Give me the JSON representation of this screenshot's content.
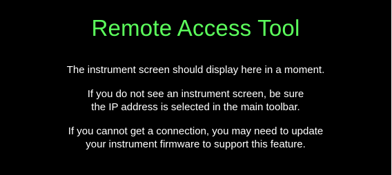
{
  "title": "Remote Access Tool",
  "messages": [
    "The instrument screen should display here in a moment.",
    "If you do not see an instrument screen, be sure",
    "the IP address is selected in the main toolbar.",
    "If you cannot get a connection, you may need to update",
    "your instrument firmware to support this feature."
  ],
  "colors": {
    "background": "#000000",
    "title": "#5cff5c",
    "text": "#ffffff"
  }
}
